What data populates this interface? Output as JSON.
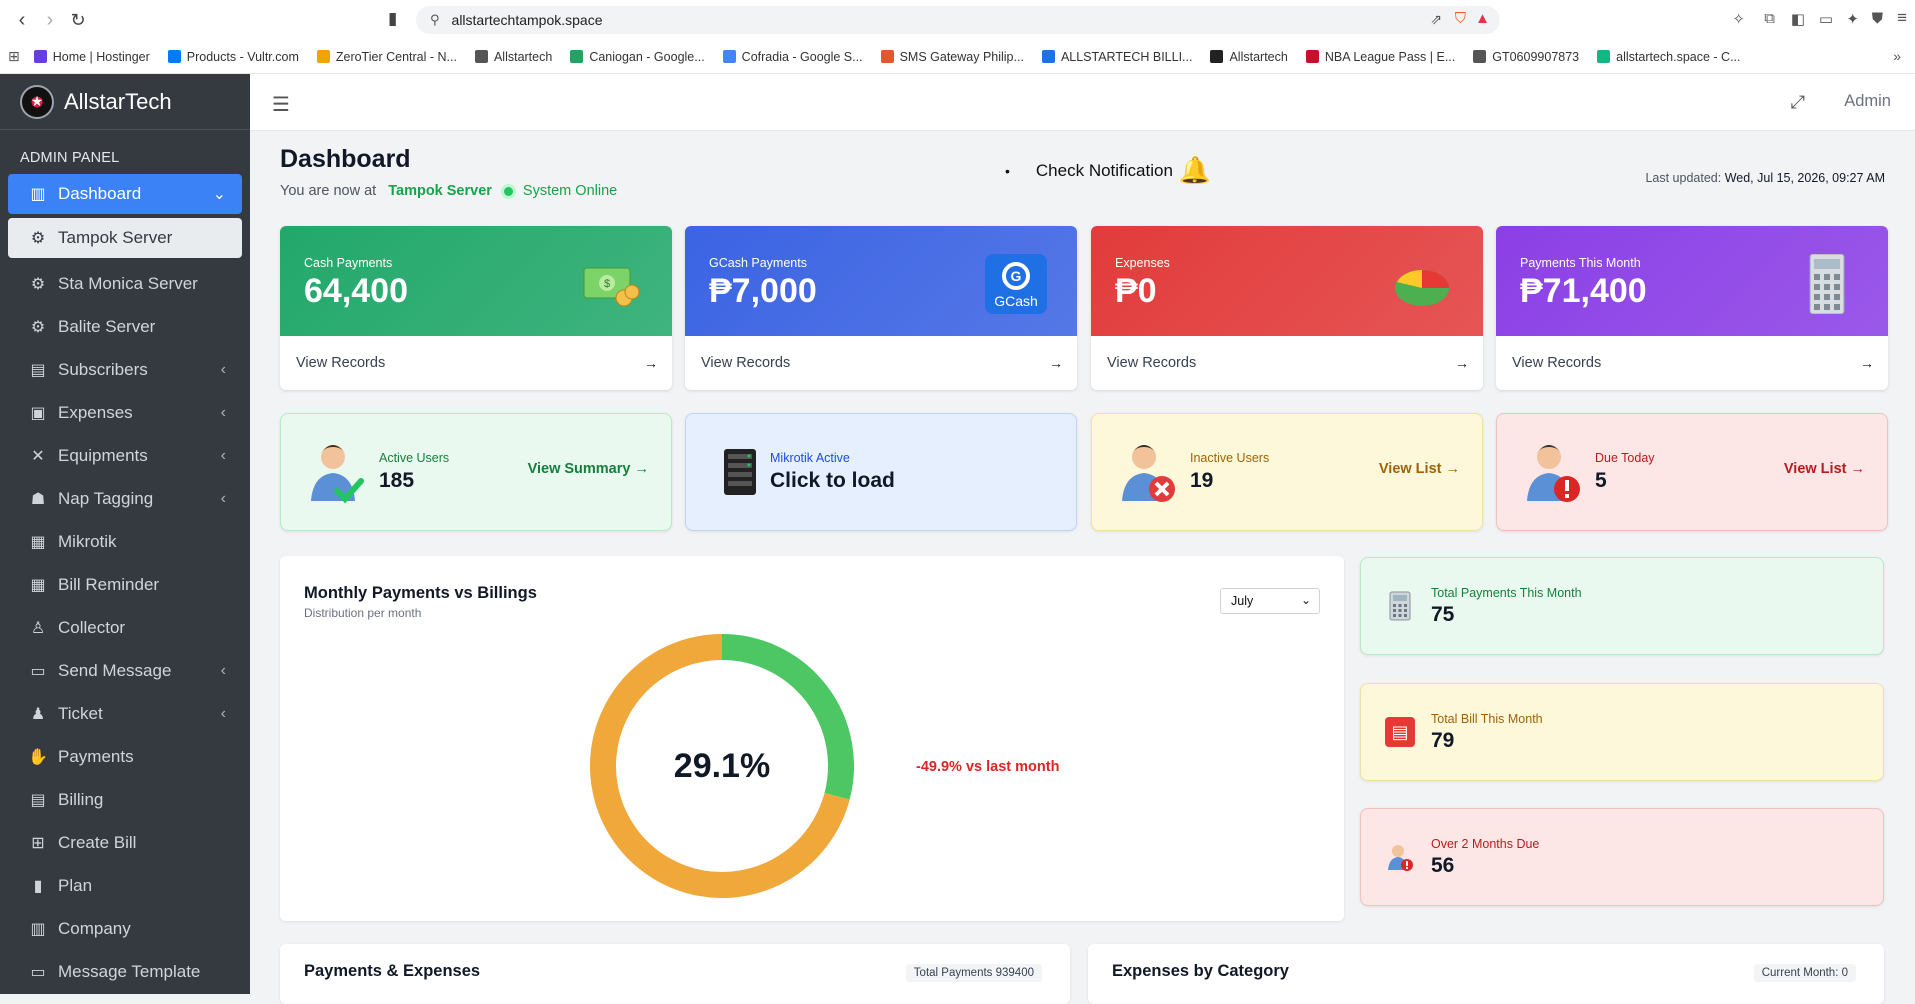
{
  "browser": {
    "url": "allstartechtampok.space",
    "bookmarks": [
      {
        "label": "Home | Hostinger",
        "color": "#673de6"
      },
      {
        "label": "Products - Vultr.com",
        "color": "#007bfc"
      },
      {
        "label": "ZeroTier Central - N...",
        "color": "#f0a400"
      },
      {
        "label": "Allstartech",
        "color": "#555555"
      },
      {
        "label": "Caniogan - Google...",
        "color": "#1fa463"
      },
      {
        "label": "Cofradia - Google S...",
        "color": "#4285f4"
      },
      {
        "label": "SMS Gateway Philip...",
        "color": "#e4572e"
      },
      {
        "label": "ALLSTARTECH BILLI...",
        "color": "#1a73e8"
      },
      {
        "label": "Allstartech",
        "color": "#222222"
      },
      {
        "label": "NBA League Pass | E...",
        "color": "#c8102e"
      },
      {
        "label": "GT0609907873",
        "color": "#555555"
      },
      {
        "label": "allstartech.space - C...",
        "color": "#10b981"
      }
    ]
  },
  "sidebar": {
    "brand": "AllstarTech",
    "panel_title": "ADMIN PANEL",
    "items": [
      {
        "label": "Dashboard",
        "icon": "dashboard-icon",
        "glyph": "▥",
        "chevron": true,
        "state": "active"
      },
      {
        "label": "Tampok Server",
        "icon": "gear-icon",
        "glyph": "⚙",
        "chevron": false,
        "state": "sub-active"
      },
      {
        "label": "Sta Monica Server",
        "icon": "gear-icon",
        "glyph": "⚙",
        "chevron": false,
        "state": ""
      },
      {
        "label": "Balite Server",
        "icon": "gear-icon",
        "glyph": "⚙",
        "chevron": false,
        "state": ""
      },
      {
        "label": "Subscribers",
        "icon": "id-card-icon",
        "glyph": "▤",
        "chevron": true,
        "state": ""
      },
      {
        "label": "Expenses",
        "icon": "money-icon",
        "glyph": "▣",
        "chevron": true,
        "state": ""
      },
      {
        "label": "Equipments",
        "icon": "tools-icon",
        "glyph": "✕",
        "chevron": true,
        "state": ""
      },
      {
        "label": "Nap Tagging",
        "icon": "network-icon",
        "glyph": "☗",
        "chevron": true,
        "state": ""
      },
      {
        "label": "Mikrotik",
        "icon": "server-icon",
        "glyph": "▦",
        "chevron": false,
        "state": ""
      },
      {
        "label": "Bill Reminder",
        "icon": "calendar-icon",
        "glyph": "▦",
        "chevron": false,
        "state": ""
      },
      {
        "label": "Collector",
        "icon": "user-icon",
        "glyph": "♙",
        "chevron": false,
        "state": ""
      },
      {
        "label": "Send Message",
        "icon": "message-icon",
        "glyph": "▭",
        "chevron": true,
        "state": ""
      },
      {
        "label": "Ticket",
        "icon": "users-gear-icon",
        "glyph": "♟",
        "chevron": true,
        "state": ""
      },
      {
        "label": "Payments",
        "icon": "hand-coin-icon",
        "glyph": "✋",
        "chevron": false,
        "state": ""
      },
      {
        "label": "Billing",
        "icon": "receipt-icon",
        "glyph": "▤",
        "chevron": false,
        "state": ""
      },
      {
        "label": "Create Bill",
        "icon": "calendar-plus-icon",
        "glyph": "⊞",
        "chevron": false,
        "state": ""
      },
      {
        "label": "Plan",
        "icon": "file-icon",
        "glyph": "▮",
        "chevron": false,
        "state": ""
      },
      {
        "label": "Company",
        "icon": "building-icon",
        "glyph": "▥",
        "chevron": false,
        "state": ""
      },
      {
        "label": "Message Template",
        "icon": "message-icon",
        "glyph": "▭",
        "chevron": false,
        "state": ""
      }
    ]
  },
  "topbar": {
    "admin": "Admin"
  },
  "header": {
    "title": "Dashboard",
    "location_prefix": "You are now at",
    "server": "Tampok Server",
    "status": "System Online",
    "notification": "Check Notification",
    "updated_label": "Last updated:",
    "updated_value": "Wed, Jul 15, 2026, 09:27 AM"
  },
  "stats": [
    {
      "label": "Cash Payments",
      "value": "64,400",
      "link": "View Records",
      "color": "#22a86a",
      "art": "cash-icon"
    },
    {
      "label": "GCash Payments",
      "value": "₱7,000",
      "link": "View Records",
      "color": "#3b63e3",
      "art": "gcash-logo"
    },
    {
      "label": "Expenses",
      "value": "₱0",
      "link": "View Records",
      "color": "#e23b3b",
      "art": "pie-icon"
    },
    {
      "label": "Payments This Month",
      "value": "₱71,400",
      "link": "View Records",
      "color": "#8b3fe6",
      "art": "calculator-icon"
    }
  ],
  "gcash_text": "GCash",
  "info": {
    "active": {
      "label": "Active Users",
      "value": "185",
      "link": "View Summary"
    },
    "mikrotik": {
      "label": "Mikrotik Active",
      "value": "Click to load"
    },
    "inactive": {
      "label": "Inactive Users",
      "value": "19",
      "link": "View List"
    },
    "due": {
      "label": "Due Today",
      "value": "5",
      "link": "View List"
    }
  },
  "chart": {
    "title": "Monthly Payments vs Billings",
    "subtitle": "Distribution per month",
    "selected_month": "July",
    "delta": "-49.9% vs last month"
  },
  "chart_data": {
    "type": "pie",
    "center_label": "29.1%",
    "slices": [
      {
        "value": 29.1,
        "color": "#4cc764"
      },
      {
        "value": 70.9,
        "color": "#f0a83a"
      }
    ]
  },
  "mini": [
    {
      "label": "Total Payments This Month",
      "value": "75",
      "icon": "calculator-icon"
    },
    {
      "label": "Total Bill This Month",
      "value": "79",
      "icon": "bill-icon"
    },
    {
      "label": "Over 2 Months Due",
      "value": "56",
      "icon": "user-alert-icon"
    }
  ],
  "bottom": {
    "left_title": "Payments & Expenses",
    "left_badge": "Total Payments 939400",
    "right_title": "Expenses by Category",
    "right_badge": "Current Month: 0"
  }
}
